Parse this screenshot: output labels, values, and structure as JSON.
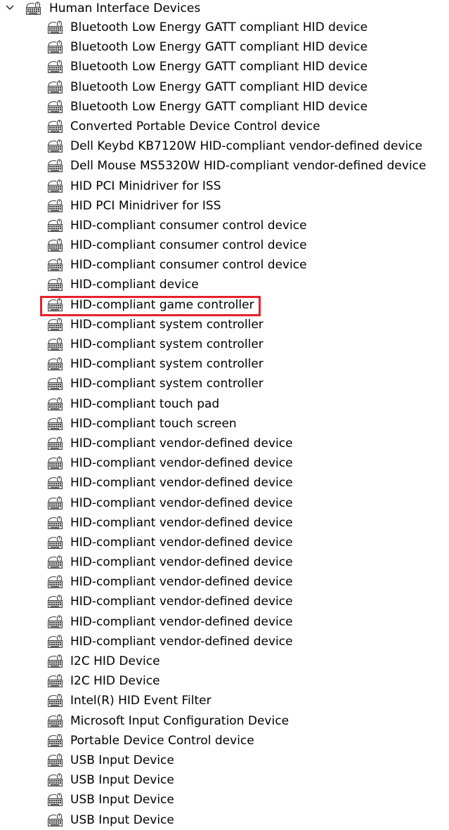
{
  "tree": {
    "category": {
      "label": "Human Interface Devices",
      "expanded": true,
      "icon": "hid-device-icon"
    },
    "highlight_color": "#e8202a",
    "devices": [
      {
        "label": "Bluetooth Low Energy GATT compliant HID device"
      },
      {
        "label": "Bluetooth Low Energy GATT compliant HID device"
      },
      {
        "label": "Bluetooth Low Energy GATT compliant HID device"
      },
      {
        "label": "Bluetooth Low Energy GATT compliant HID device"
      },
      {
        "label": "Bluetooth Low Energy GATT compliant HID device"
      },
      {
        "label": "Converted Portable Device Control device"
      },
      {
        "label": "Dell Keybd KB7120W HID-compliant vendor-defined device"
      },
      {
        "label": "Dell Mouse MS5320W HID-compliant vendor-defined device"
      },
      {
        "label": "HID PCI Minidriver for ISS"
      },
      {
        "label": "HID PCI Minidriver for ISS"
      },
      {
        "label": "HID-compliant consumer control device"
      },
      {
        "label": "HID-compliant consumer control device"
      },
      {
        "label": "HID-compliant consumer control device"
      },
      {
        "label": "HID-compliant device"
      },
      {
        "label": "HID-compliant game controller",
        "highlighted": true
      },
      {
        "label": "HID-compliant system controller"
      },
      {
        "label": "HID-compliant system controller"
      },
      {
        "label": "HID-compliant system controller"
      },
      {
        "label": "HID-compliant system controller"
      },
      {
        "label": "HID-compliant touch pad"
      },
      {
        "label": "HID-compliant touch screen"
      },
      {
        "label": "HID-compliant vendor-defined device"
      },
      {
        "label": "HID-compliant vendor-defined device"
      },
      {
        "label": "HID-compliant vendor-defined device"
      },
      {
        "label": "HID-compliant vendor-defined device"
      },
      {
        "label": "HID-compliant vendor-defined device"
      },
      {
        "label": "HID-compliant vendor-defined device"
      },
      {
        "label": "HID-compliant vendor-defined device"
      },
      {
        "label": "HID-compliant vendor-defined device"
      },
      {
        "label": "HID-compliant vendor-defined device"
      },
      {
        "label": "HID-compliant vendor-defined device"
      },
      {
        "label": "HID-compliant vendor-defined device"
      },
      {
        "label": "I2C HID Device"
      },
      {
        "label": "I2C HID Device"
      },
      {
        "label": "Intel(R) HID Event Filter"
      },
      {
        "label": "Microsoft Input Configuration Device"
      },
      {
        "label": "Portable Device Control device"
      },
      {
        "label": "USB Input Device"
      },
      {
        "label": "USB Input Device"
      },
      {
        "label": "USB Input Device"
      },
      {
        "label": "USB Input Device"
      }
    ]
  }
}
